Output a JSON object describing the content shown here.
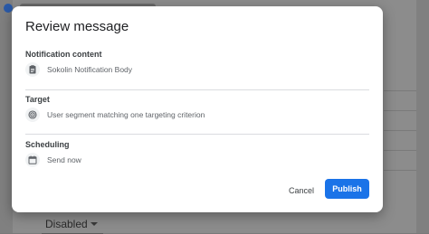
{
  "background": {
    "dropdown_value": "Disabled"
  },
  "dialog": {
    "title": "Review message",
    "sections": [
      {
        "title": "Notification content",
        "icon": "clipboard-icon",
        "value": "Sokolin Notification Body"
      },
      {
        "title": "Target",
        "icon": "target-icon",
        "value": "User segment matching one targeting criterion"
      },
      {
        "title": "Scheduling",
        "icon": "calendar-icon",
        "value": "Send now"
      }
    ],
    "cancel_label": "Cancel",
    "publish_label": "Publish"
  },
  "colors": {
    "accent": "#1a73e8",
    "icon": "#5f6368",
    "divider": "#dadce0"
  }
}
